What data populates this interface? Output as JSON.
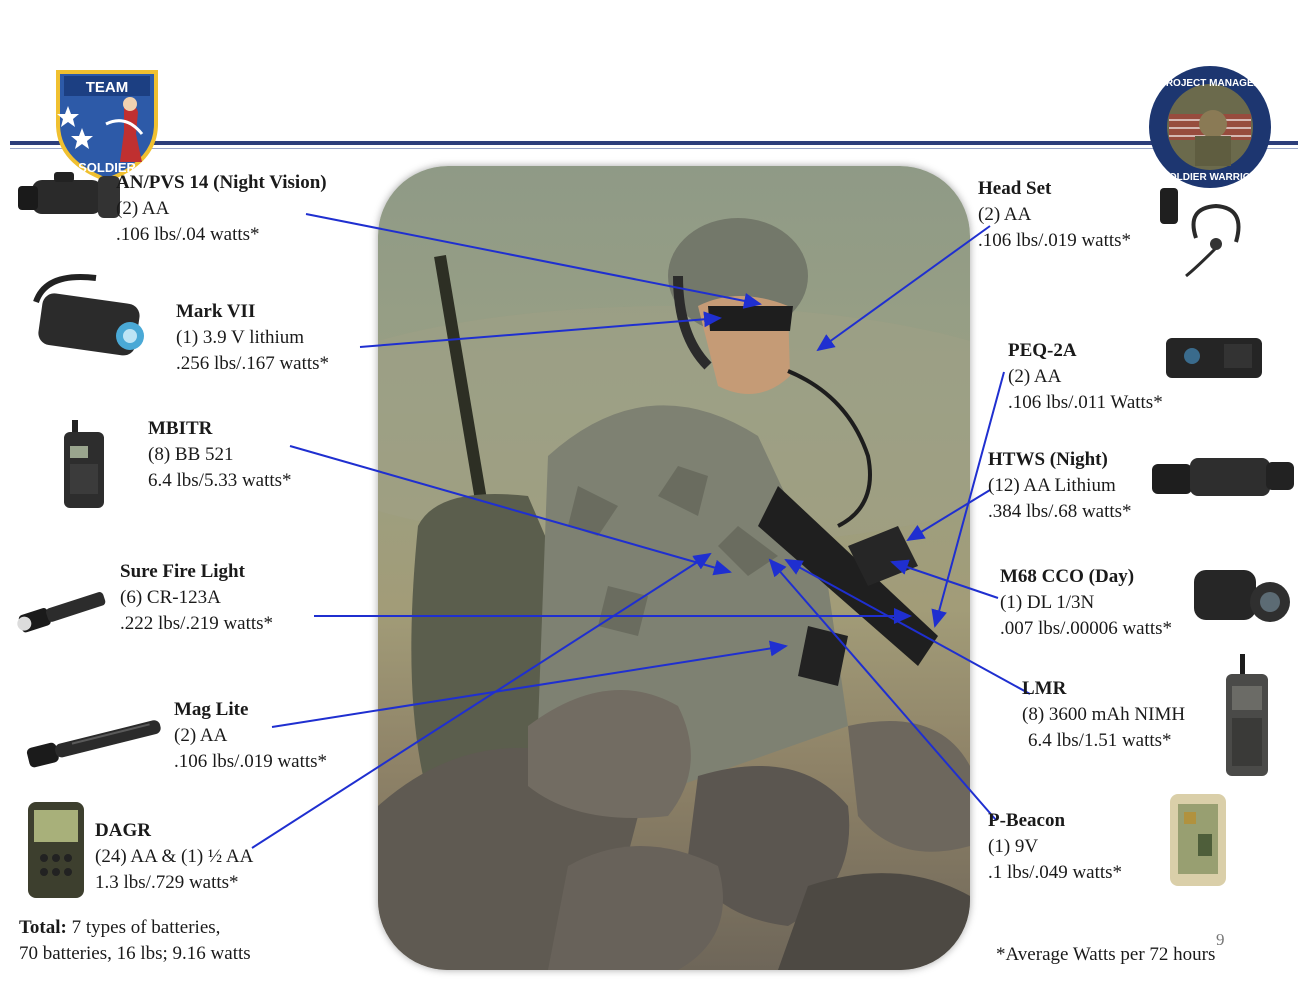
{
  "logos": {
    "left_text": "TEAM",
    "left_lower_text": "SOLDIER",
    "right_text": "PROJECT MANAGER",
    "right_lower_text": "SOLDIER WARRIOR"
  },
  "items": {
    "anpvs": {
      "title": "AN/PVS 14 (Night Vision)",
      "batt": "(2) AA",
      "spec": ".106 lbs/.04 watts*"
    },
    "mark7": {
      "title": "Mark VII",
      "batt": "(1) 3.9 V lithium",
      "spec": ".256 lbs/.167 watts*"
    },
    "mbitr": {
      "title": "MBITR",
      "batt": "(8) BB 521",
      "spec": "6.4 lbs/5.33 watts*"
    },
    "surefire": {
      "title": "Sure Fire Light",
      "batt": "(6) CR-123A",
      "spec": ".222 lbs/.219 watts*"
    },
    "maglite": {
      "title": "Mag Lite",
      "batt": "(2) AA",
      "spec": ".106 lbs/.019 watts*"
    },
    "dagr": {
      "title": "DAGR",
      "batt": "(24) AA & (1) ½ AA",
      "spec": "1.3 lbs/.729 watts*"
    },
    "headset": {
      "title": "Head Set",
      "batt": "(2) AA",
      "spec": ".106 lbs/.019 watts*"
    },
    "peq": {
      "title": "PEQ-2A",
      "batt": "(2) AA",
      "spec": ".106 lbs/.011 Watts*"
    },
    "htws": {
      "title": "HTWS (Night)",
      "batt": "(12) AA Lithium",
      "spec": ".384 lbs/.68 watts*"
    },
    "m68": {
      "title": "M68 CCO (Day)",
      "batt": "(1) DL 1/3N",
      "spec": ".007 lbs/.00006 watts*"
    },
    "lmr": {
      "title": "LMR",
      "batt": "(8) 3600 mAh NIMH",
      "spec": "6.4 lbs/1.51 watts*"
    },
    "pbeacon": {
      "title": "P-Beacon",
      "batt": "(1) 9V",
      "spec": ".1 lbs/.049 watts*"
    }
  },
  "total": {
    "label": "Total:",
    "line1": " 7 types of batteries,",
    "line2": "70 batteries, 16 lbs;  9.16  watts"
  },
  "footnote": "*Average Watts per 72 hours",
  "page_number": "9",
  "colors": {
    "leader_lines": "#1f2fd0",
    "rule": "#2c3e7a"
  }
}
